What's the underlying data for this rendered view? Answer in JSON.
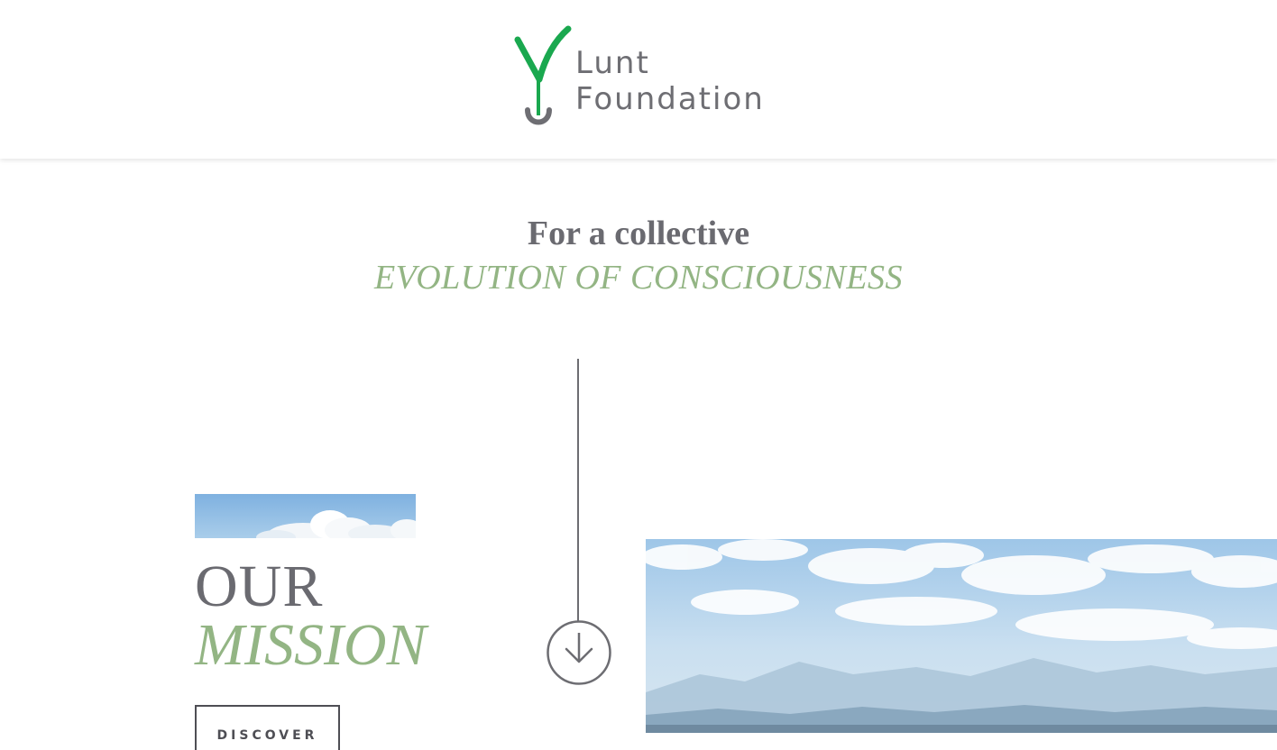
{
  "header": {
    "logo_line1": "Lunt",
    "logo_line2": "Foundation"
  },
  "hero": {
    "tagline_line1": "For a collective",
    "tagline_line2": "EVOLUTION OF CONSCIOUSNESS"
  },
  "mission": {
    "title_line1": "OUR",
    "title_line2": "MISSION",
    "button_label": "DISCOVER"
  },
  "icons": {
    "logo": "sprout-logo-icon",
    "scroll": "arrow-down-circle-icon"
  },
  "colors": {
    "text_gray": "#6a6a70",
    "accent_green": "#93b584",
    "logo_green": "#1aa84f",
    "sky_blue": "#a9cdea"
  }
}
